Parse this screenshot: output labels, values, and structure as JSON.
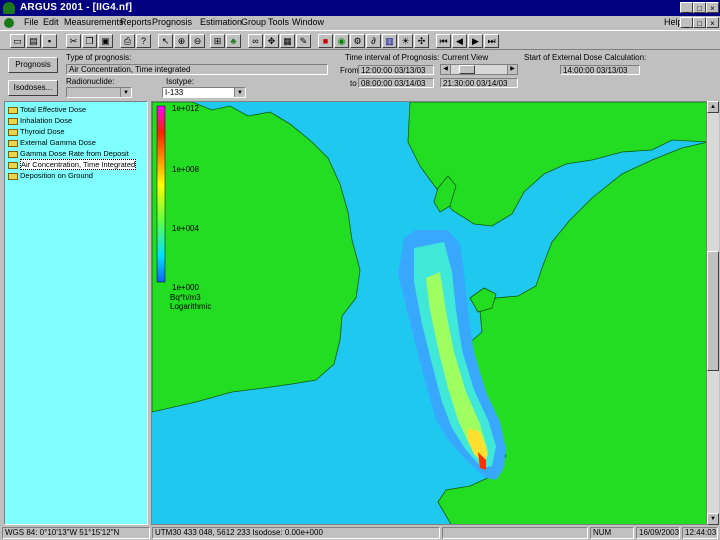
{
  "window": {
    "title": "ARGUS 2001 - [IIG4.nf]",
    "controls": [
      "_",
      "□",
      "×"
    ],
    "inner_controls": [
      "_",
      "□",
      "×"
    ]
  },
  "menu": {
    "items": [
      "File",
      "Edit",
      "Measurements",
      "Reports",
      "Prognosis",
      "Estimation",
      "Group",
      "Tools",
      "Window"
    ],
    "help": "Help"
  },
  "panel": {
    "prognosis_button": "Prognosis",
    "isodoses_button": "Isodoses...",
    "type_label": "Type of prognosis:",
    "type_value": "Air Concentration, Time integrated",
    "nuclide_label": "Radionuclide:",
    "nuclide_value": "",
    "isotype_label": "Isotype:",
    "isotype_value": "I-133",
    "time_interval_label": "Time interval of Prognosis:",
    "from_label": "From",
    "from_value": "12:00:00 03/13/03",
    "to_label": "to",
    "to_value": "08:00:00 03/14/03",
    "current_view_label": "Current View",
    "current_view_value": "21:30:00 03/14/03",
    "start_label": "Start of External Dose Calculation:",
    "start_value": "14:00:00 03/13/03"
  },
  "sidebar": {
    "items": [
      "Total Effective Dose",
      "Inhalation Dose",
      "Thyroid Dose",
      "External Gamma Dose",
      "Gamma Dose Rate from Deposit",
      "Air Concentration, Time Integrated",
      "Deposition on Ground"
    ],
    "selected_index": 5
  },
  "legend": {
    "ticks": [
      "1e+012",
      "1e+008",
      "1e+004",
      "1e+000"
    ],
    "unit": "Bq*h/m3",
    "scale": "Logarithmic"
  },
  "status": {
    "coords": "WGS 84: 0°10'13\"W  51°15'12\"N",
    "utm": "UTM30    433 048, 5612 233   Isodose: 0.00e+000",
    "num": "NUM",
    "date": "16/09/2003",
    "time": "12:44:03"
  },
  "colors": {
    "sea": "#1ec8ee",
    "land": "#22dd22",
    "title_bar": "#000080",
    "sidebar_bg": "#7fffff"
  }
}
